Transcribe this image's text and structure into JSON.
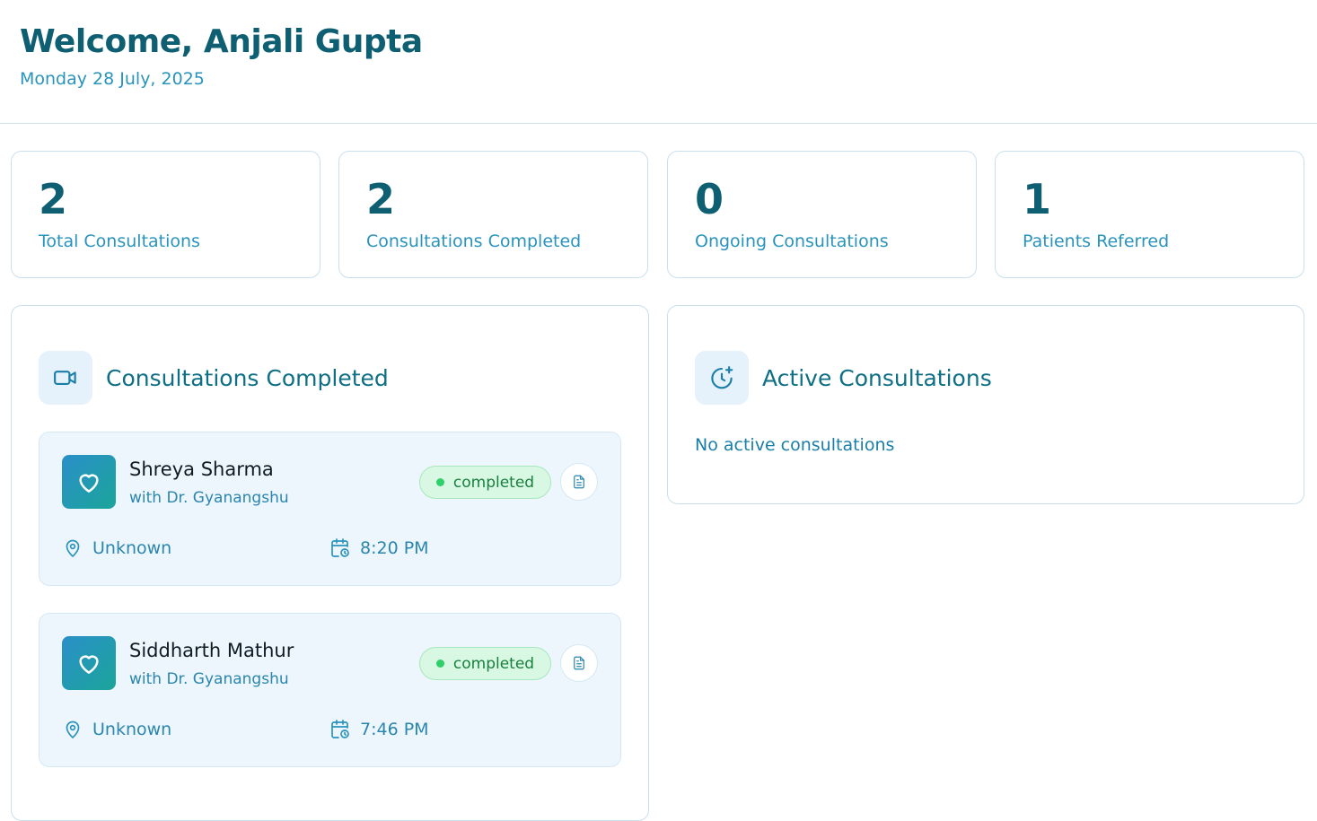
{
  "header": {
    "title": "Welcome, Anjali Gupta",
    "date": "Monday 28 July, 2025"
  },
  "stats": [
    {
      "value": "2",
      "label": "Total Consultations"
    },
    {
      "value": "2",
      "label": "Consultations Completed"
    },
    {
      "value": "0",
      "label": "Ongoing Consultations"
    },
    {
      "value": "1",
      "label": "Patients Referred"
    }
  ],
  "completed_panel": {
    "title": "Consultations Completed",
    "icon": "video-camera-icon",
    "items": [
      {
        "patient": "Shreya Sharma",
        "doctor": "with Dr. Gyanangshu",
        "status": "completed",
        "location": "Unknown",
        "time": "8:20 PM"
      },
      {
        "patient": "Siddharth Mathur",
        "doctor": "with Dr. Gyanangshu",
        "status": "completed",
        "location": "Unknown",
        "time": "7:46 PM"
      }
    ]
  },
  "active_panel": {
    "title": "Active Consultations",
    "icon": "clock-plus-icon",
    "empty_text": "No active consultations"
  },
  "colors": {
    "primary": "#0f5f73",
    "accent": "#2a93bd",
    "status_green": "#2fcf6a"
  }
}
